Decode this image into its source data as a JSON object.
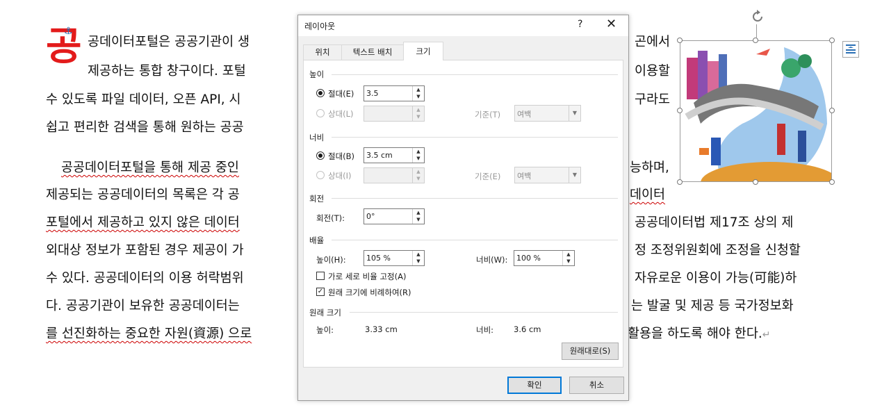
{
  "document": {
    "dropcap": "공",
    "lines": [
      "공데이터포털은 공공기관이 생",
      "제공하는 통합 창구이다. 포털",
      "수 있도록 파일 데이터, 오픈 API, 시",
      "쉽고 편리한 검색을 통해 원하는 공공",
      "공공데이터포털을 통해 제공 중인",
      "제공되는 공공데이터의 목록은 각 공",
      "포털에서 제공하고 있지 않은 데이터",
      "외대상 정보가 포함된 경우 제공이 가",
      "수 있다. 공공데이터의 이용 허락범위",
      "다. 공공기관이 보유한 공공데이터는",
      "를 선진화하는 중요한 자원(資源) 으로"
    ],
    "right_fragments": [
      "곤에서",
      "이용할",
      "구라도",
      "능하며,",
      "데이터",
      "공공데이터법 제17조 상의 제",
      "정 조정위원회에 조정을 신청할",
      "자유로운 이용이 가능(可能)하",
      "는 발굴 및 제공 등 국가정보화",
      "활용을 하도록 해야 한다."
    ]
  },
  "dialog": {
    "title": "레이아웃",
    "help": "?",
    "close": "✕",
    "tabs": [
      "위치",
      "텍스트 배치",
      "크기"
    ],
    "active_tab": "크기",
    "height_section": "높이",
    "height_absolute_label": "절대(E)",
    "height_absolute_value": "3.5",
    "height_relative_label": "상대(L)",
    "height_relative_value": "",
    "height_base_label": "기준(T)",
    "height_base_value": "여백",
    "width_section": "너비",
    "width_absolute_label": "절대(B)",
    "width_absolute_value": "3.5 cm",
    "width_relative_label": "상대(I)",
    "width_relative_value": "",
    "width_base_label": "기준(E)",
    "width_base_value": "여백",
    "rotate_section": "회전",
    "rotate_label": "회전(T):",
    "rotate_value": "0°",
    "scale_section": "배율",
    "scale_height_label": "높이(H):",
    "scale_height_value": "105 %",
    "scale_width_label": "너비(W):",
    "scale_width_value": "100 %",
    "lock_aspect_label": "가로 세로 비율 고정(A)",
    "relative_original_label": "원래 크기에 비례하여(R)",
    "original_section": "원래 크기",
    "orig_height_label": "높이:",
    "orig_height_value": "3.33 cm",
    "orig_width_label": "너비:",
    "orig_width_value": "3.6 cm",
    "reset_button": "원래대로(S)",
    "ok_button": "확인",
    "cancel_button": "취소"
  }
}
